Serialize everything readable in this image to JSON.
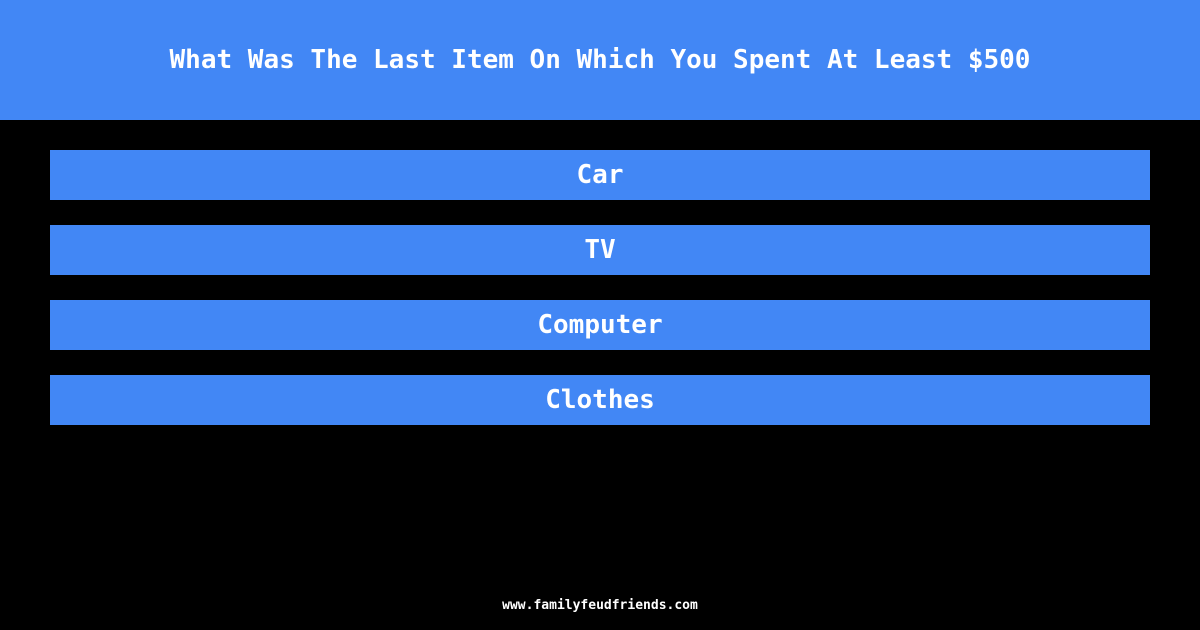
{
  "header": {
    "title": "What Was The Last Item On Which You Spent At Least $500"
  },
  "answers": [
    {
      "label": "Car"
    },
    {
      "label": "TV"
    },
    {
      "label": "Computer"
    },
    {
      "label": "Clothes"
    }
  ],
  "footer": {
    "site": "www.familyfeudfriends.com"
  },
  "colors": {
    "accent": "#4287f5",
    "background": "#000000",
    "text": "#ffffff"
  }
}
